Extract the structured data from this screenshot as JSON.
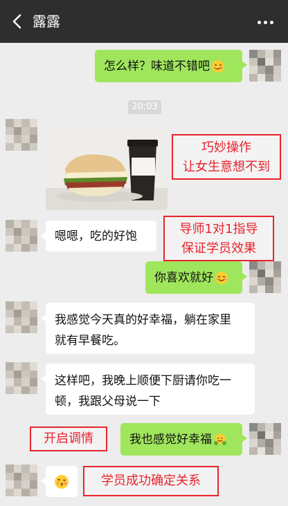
{
  "header": {
    "title": "露露",
    "back_icon": "chevron-left-icon",
    "more_icon": "more-dots-icon",
    "background": "#2e2e2e"
  },
  "colors": {
    "sent_bubble": "#9fe65c",
    "received_bubble": "#ffffff",
    "annotation": "#e8232c",
    "chat_background": "#ededed"
  },
  "messages": [
    {
      "from": "me",
      "text": "怎么样？味道不错吧",
      "emoji": "smirk-emoji"
    },
    {
      "type": "timestamp",
      "text": "20:03"
    },
    {
      "from": "her",
      "type": "image",
      "image": "sandwich-and-coffee-photo"
    },
    {
      "from": "her",
      "text": "嗯嗯，吃的好饱"
    },
    {
      "from": "me",
      "text": "你喜欢就好",
      "emoji": "smile-emoji"
    },
    {
      "from": "her",
      "text": "我感觉今天真的好幸福，躺在家里就有早餐吃。"
    },
    {
      "from": "her",
      "text": "这样吧，我晚上顺便下厨请你吃一顿，我跟父母说一下"
    },
    {
      "from": "me",
      "text": "我也感觉好幸福",
      "emoji": "hug-emoji"
    },
    {
      "from": "her",
      "type": "emoji",
      "emoji": "kiss-emoji"
    }
  ],
  "lines": {
    "m5_l1": "我感觉今天真的好幸福，躺在家里",
    "m5_l2": "就有早餐吃。",
    "m6_l1": "这样吧，我晚上顺便下厨请你吃一",
    "m6_l2": "顿，我跟父母说一下"
  },
  "annotations": [
    {
      "lines": [
        "巧妙操作",
        "让女生意想不到"
      ]
    },
    {
      "lines": [
        "导师1对1指导",
        "保证学员效果"
      ]
    },
    {
      "lines": [
        "开启调情"
      ]
    },
    {
      "lines": [
        "学员成功确定关系"
      ]
    }
  ]
}
